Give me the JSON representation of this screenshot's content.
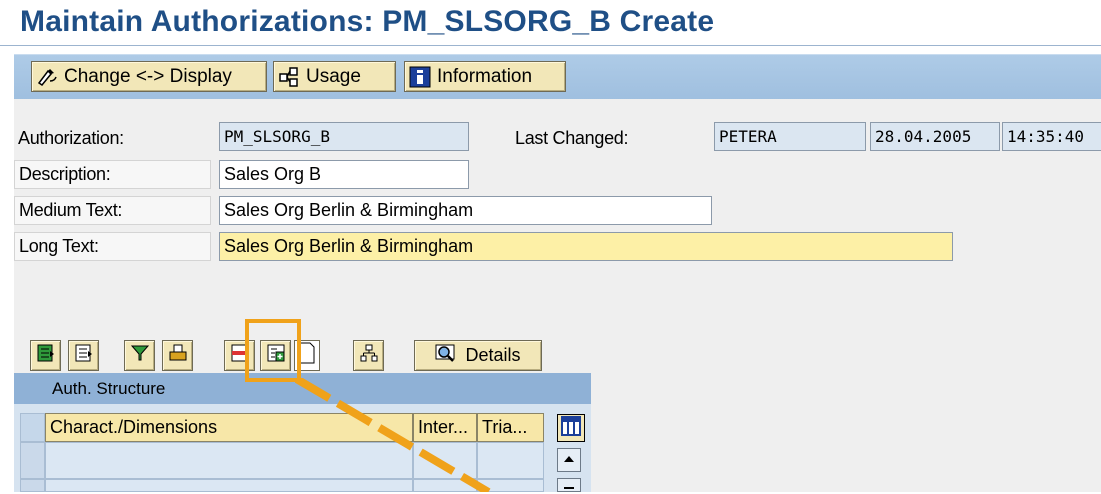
{
  "page": {
    "title": "Maintain Authorizations: PM_SLSORG_B Create"
  },
  "toolbar": {
    "change_display_label": "Change <-> Display",
    "usage_label": "Usage",
    "information_label": "Information"
  },
  "form": {
    "authorization_label": "Authorization:",
    "authorization_value": "PM_SLSORG_B",
    "last_changed_label": "Last Changed:",
    "last_changed_user": "PETERA",
    "last_changed_date": "28.04.2005",
    "last_changed_time": "14:35:40",
    "description_label": "Description:",
    "description_value": "Sales Org B",
    "medium_text_label": "Medium Text:",
    "medium_text_value": "Sales Org Berlin & Birmingham",
    "long_text_label": "Long Text:",
    "long_text_value": "Sales Org Berlin & Birmingham"
  },
  "grid_toolbar": {
    "details_label": "Details"
  },
  "grid": {
    "title": "Auth. Structure",
    "columns": [
      "Charact./Dimensions",
      "Inter...",
      "Tria..."
    ]
  },
  "icons": [
    "change-display-icon",
    "usage-icon",
    "information-icon",
    "select-all-icon",
    "deselect-all-icon",
    "filter-icon",
    "print-icon",
    "delete-row-icon",
    "insert-row-icon",
    "blank-page-icon",
    "hierarchy-icon",
    "details-icon",
    "column-config-icon",
    "scroll-up-icon",
    "scroll-down-icon"
  ],
  "colors": {
    "title": "#1f4f86",
    "toolbar": "#aecbe7",
    "button": "#f2e7b8",
    "highlight": "#f0a21a",
    "long_text_field": "#fdf0a6"
  }
}
